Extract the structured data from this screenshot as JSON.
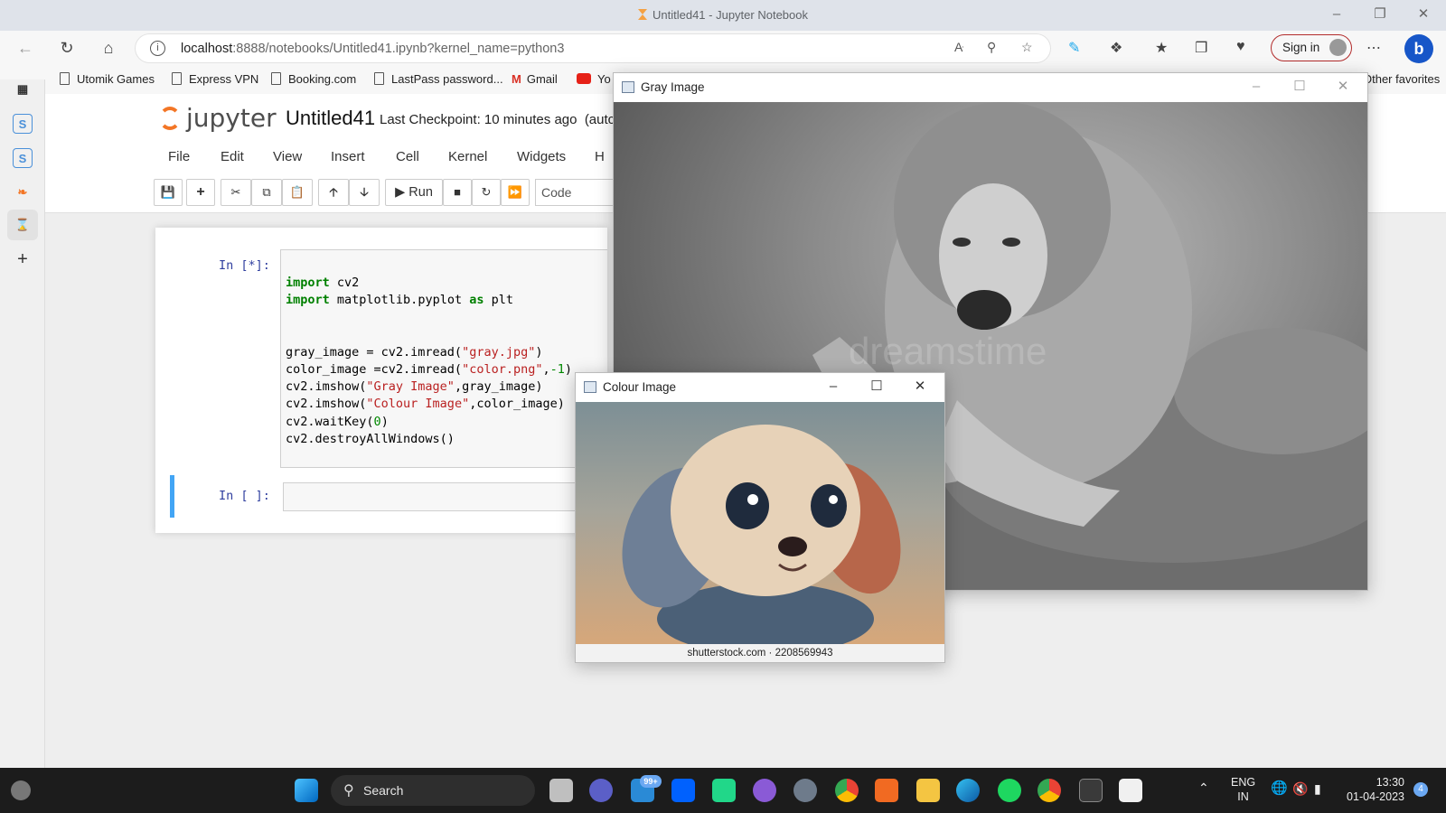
{
  "window": {
    "title": "Untitled41 - Jupyter Notebook"
  },
  "browser": {
    "url_host": "localhost",
    "url_rest": ":8888/notebooks/Untitled41.ipynb?kernel_name=python3",
    "sign_in_label": "Sign in",
    "favorites": [
      {
        "label": "Utomik Games",
        "icon": "page-icon"
      },
      {
        "label": "Express VPN",
        "icon": "page-icon"
      },
      {
        "label": "Booking.com",
        "icon": "page-icon"
      },
      {
        "label": "LastPass password...",
        "icon": "page-icon"
      },
      {
        "label": "Gmail",
        "icon": "gmail-icon"
      },
      {
        "label": "Yo",
        "icon": "youtube-icon"
      }
    ],
    "other_favorites": "Other favorites"
  },
  "jupyter": {
    "logo_text": "jupyter",
    "notebook_name": "Untitled41",
    "checkpoint": "Last Checkpoint: 10 minutes ago",
    "autosave": "(autc",
    "menu": [
      "File",
      "Edit",
      "View",
      "Insert",
      "Cell",
      "Kernel",
      "Widgets",
      "H"
    ],
    "run_label": "Run",
    "cell_type": "Code",
    "cells": [
      {
        "prompt": "In [*]:",
        "code_lines": [
          "import cv2",
          "import matplotlib.pyplot as plt",
          "",
          "",
          "gray_image = cv2.imread(\"gray.jpg\")",
          "color_image =cv2.imread(\"color.png\",-1)",
          "cv2.imshow(\"Gray Image\",gray_image)",
          "cv2.imshow(\"Colour Image\",color_image)",
          "cv2.waitKey(0)",
          "cv2.destroyAllWindows()"
        ]
      },
      {
        "prompt": "In [ ]:",
        "code_lines": []
      }
    ]
  },
  "gray_window": {
    "title": "Gray Image",
    "watermark": "dreamstime"
  },
  "colour_window": {
    "title": "Colour Image",
    "caption": "shutterstock.com · 2208569943"
  },
  "taskbar": {
    "search_label": "Search",
    "mail_badge": "99+",
    "lang_top": "ENG",
    "lang_bottom": "IN",
    "time": "13:30",
    "date": "01-04-2023",
    "notification_count": "4"
  },
  "colors": {
    "jupyter_orange": "#f37626",
    "prompt_blue": "#303f9f",
    "selected_cell_border": "#42a5f5",
    "keyword_green": "#008000",
    "string_red": "#ba2121"
  }
}
